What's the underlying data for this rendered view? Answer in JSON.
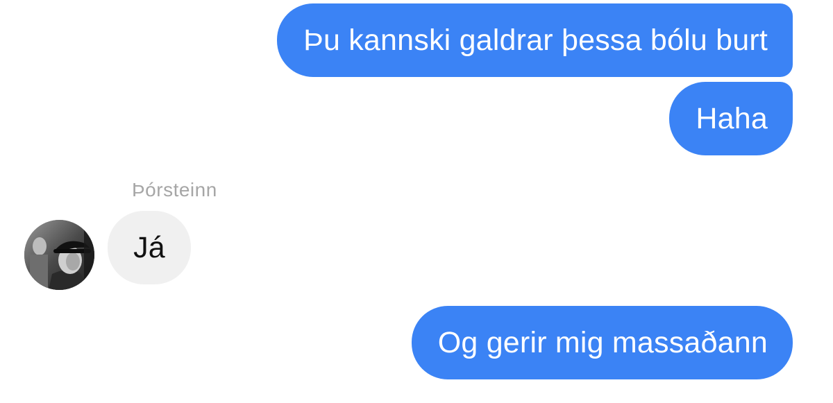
{
  "conversation": {
    "messages": [
      {
        "direction": "outgoing",
        "text": "Þu kannski galdrar þessa bólu burt"
      },
      {
        "direction": "outgoing",
        "text": "Haha"
      },
      {
        "direction": "incoming",
        "sender": "Þórsteinn",
        "text": "Já",
        "avatar_icon": "user-avatar-photo"
      },
      {
        "direction": "outgoing",
        "text": "Og gerir mig massaðann"
      }
    ]
  },
  "colors": {
    "outgoing_bubble": "#3b83f5",
    "incoming_bubble": "#f0f0f0",
    "sender_name": "#a6a6a6",
    "background": "#ffffff"
  }
}
